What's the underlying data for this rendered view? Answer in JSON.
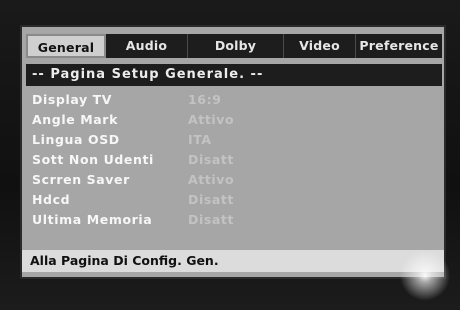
{
  "tabs": [
    {
      "label": "General"
    },
    {
      "label": "Audio"
    },
    {
      "label": "Dolby"
    },
    {
      "label": "Video"
    },
    {
      "label": "Preference"
    }
  ],
  "title": "-- Pagina Setup Generale. --",
  "settings": [
    {
      "label": "Display TV",
      "value": "16:9"
    },
    {
      "label": "Angle Mark",
      "value": "Attivo"
    },
    {
      "label": "Lingua OSD",
      "value": "ITA"
    },
    {
      "label": "Sott Non Udenti",
      "value": "Disatt"
    },
    {
      "label": "Scrren Saver",
      "value": "Attivo"
    },
    {
      "label": "Hdcd",
      "value": "Disatt"
    },
    {
      "label": "Ultima Memoria",
      "value": "Disatt"
    }
  ],
  "footer": "Alla Pagina Di Config. Gen."
}
